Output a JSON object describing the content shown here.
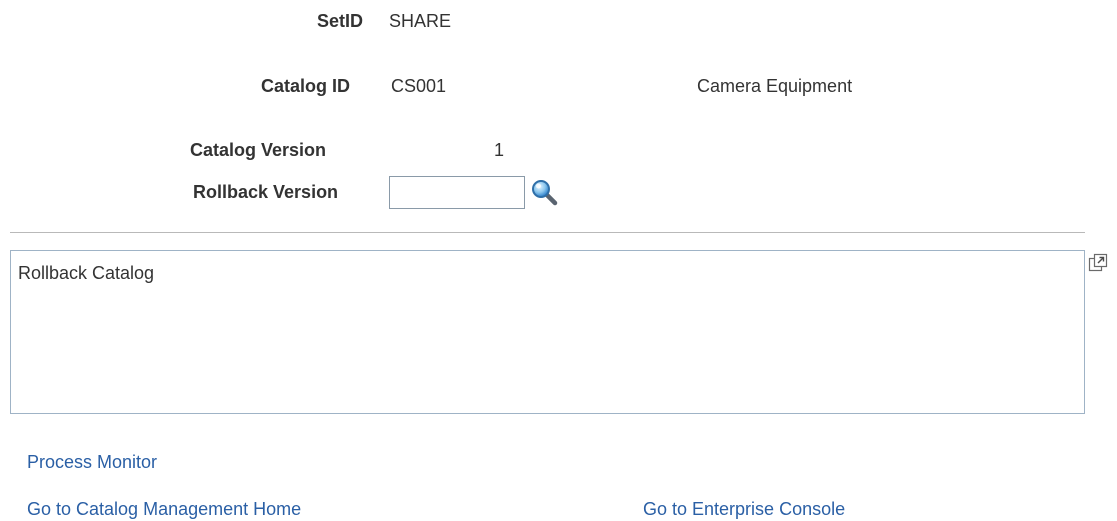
{
  "setid": {
    "label": "SetID",
    "value": "SHARE"
  },
  "catalog_id": {
    "label": "Catalog ID",
    "value": "CS001",
    "description": "Camera Equipment"
  },
  "catalog_version": {
    "label": "Catalog Version",
    "value": "1"
  },
  "rollback_version": {
    "label": "Rollback Version",
    "value": "",
    "lookup_icon": "search-icon"
  },
  "description_box": {
    "value": "Rollback Catalog",
    "expand_icon": "expand-icon"
  },
  "links": {
    "process_monitor": "Process Monitor",
    "catalog_home": "Go to Catalog Management Home",
    "enterprise_console": "Go to Enterprise Console"
  },
  "colors": {
    "link": "#2a5fa5",
    "text": "#333333",
    "border": "#9fb3c6"
  }
}
